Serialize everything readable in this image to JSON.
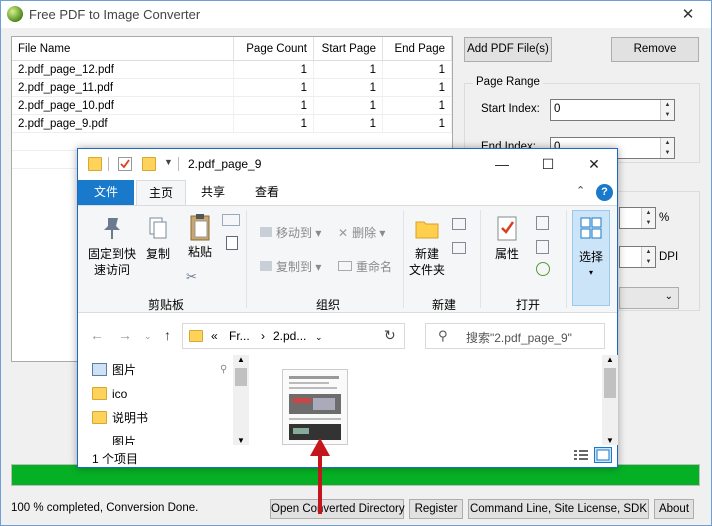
{
  "app": {
    "title": "Free PDF to Image Converter",
    "close_glyph": "✕"
  },
  "file_list": {
    "columns": [
      "File Name",
      "Page Count",
      "Start Page",
      "End Page"
    ],
    "rows": [
      {
        "name": "2.pdf_page_12.pdf",
        "count": "1",
        "start": "1",
        "end": "1"
      },
      {
        "name": "2.pdf_page_11.pdf",
        "count": "1",
        "start": "1",
        "end": "1"
      },
      {
        "name": "2.pdf_page_10.pdf",
        "count": "1",
        "start": "1",
        "end": "1"
      },
      {
        "name": "2.pdf_page_9.pdf",
        "count": "1",
        "start": "1",
        "end": "1"
      }
    ]
  },
  "buttons": {
    "add_pdf": "Add PDF File(s)",
    "remove": "Remove"
  },
  "page_range": {
    "title": "Page Range",
    "start_label": "Start Index:",
    "start_value": "0",
    "end_label": "End Index:",
    "end_value": "0"
  },
  "options": {
    "percent_unit": "%",
    "dpi_unit": "DPI"
  },
  "progress": {
    "fraction": 1.0,
    "color": "#06b025"
  },
  "status_text": "100 % completed, Conversion Done.",
  "bottom_buttons": {
    "open_dir": "Open Converted Directory",
    "register": "Register",
    "command_line": "Command Line, Site License, SDK",
    "about": "About"
  },
  "explorer": {
    "title": "2.pdf_page_9",
    "controls": {
      "minimize": "—",
      "maximize": "☐",
      "close": "✕"
    },
    "tabs": [
      "文件",
      "主页",
      "共享",
      "查看"
    ],
    "ribbon": {
      "pin": "固定到快速访问",
      "pin_line1": "固定到快",
      "pin_line2": "速访问",
      "copy": "复制",
      "paste": "粘贴",
      "clipboard_group": "剪贴板",
      "move_to": "移动到",
      "copy_to": "复制到",
      "delete": "删除",
      "rename": "重命名",
      "organize_group": "组织",
      "new_folder_line1": "新建",
      "new_folder_line2": "文件夹",
      "new_group": "新建",
      "properties": "属性",
      "open_group": "打开",
      "select": "选择"
    },
    "address": {
      "prefix": "«",
      "crumb1": "Fr...",
      "crumb2": "2.pd...",
      "search_placeholder": "搜索\"2.pdf_page_9\""
    },
    "nav_items": [
      "图片",
      "ico",
      "说明书",
      "图片"
    ],
    "status": "1 个项目",
    "accent": "#1979ca"
  }
}
